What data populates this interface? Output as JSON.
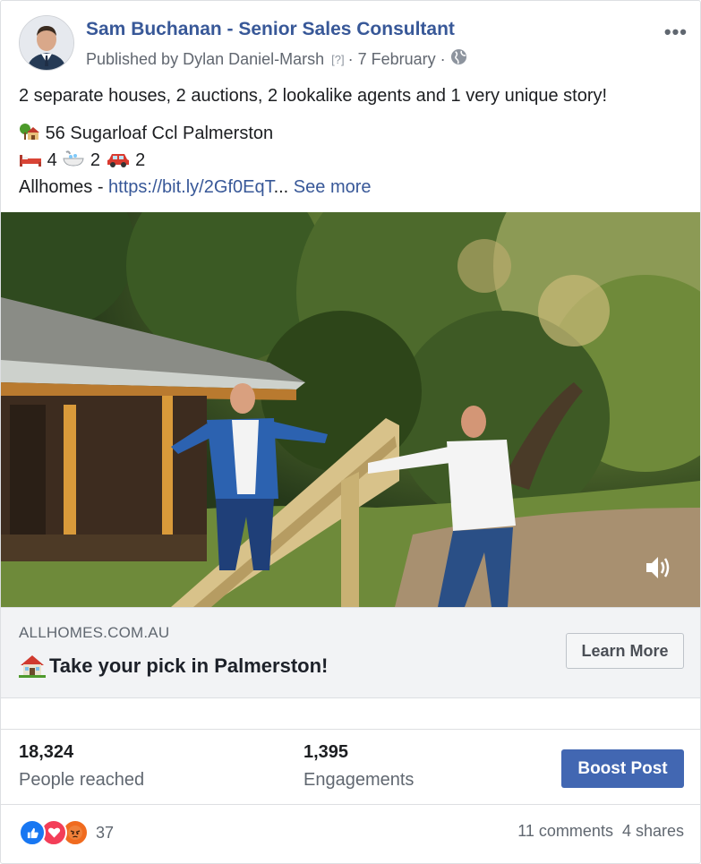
{
  "post": {
    "author_name": "Sam Buchanan - Senior Sales Consultant",
    "published_prefix": "Published by Dylan Daniel-Marsh",
    "help_marker": "[?]",
    "date": "· 7 February ·",
    "more_label": "•••",
    "body": {
      "line1": "2 separate houses, 2 auctions, 2 lookalike agents and 1 very unique story!",
      "address": "56 Sugarloaf Ccl Palmerston",
      "beds": "4",
      "baths": "2",
      "cars": "2",
      "source_prefix": "Allhomes - ",
      "link": "https://bit.ly/2Gf0EqT",
      "ellipsis": "...",
      "see_more": "See more"
    }
  },
  "preview": {
    "domain": "ALLHOMES.COM.AU",
    "headline": "Take your pick in Palmerston!",
    "cta": "Learn More"
  },
  "stats": {
    "reached_value": "18,324",
    "reached_label": "People reached",
    "engagements_value": "1,395",
    "engagements_label": "Engagements",
    "boost_label": "Boost Post"
  },
  "footer": {
    "reaction_count": "37",
    "comments": "11 comments",
    "shares": "4 shares"
  },
  "colors": {
    "link_blue": "#385898",
    "boost_blue": "#4267b2",
    "like_blue": "#1877f2",
    "love_red": "#f33e58",
    "angry_orange": "#f06b1f"
  },
  "icons": [
    "more-options-icon",
    "globe-icon",
    "house-icon",
    "bed-icon",
    "bath-icon",
    "car-icon",
    "sound-icon",
    "like-icon",
    "love-icon",
    "angry-icon"
  ]
}
